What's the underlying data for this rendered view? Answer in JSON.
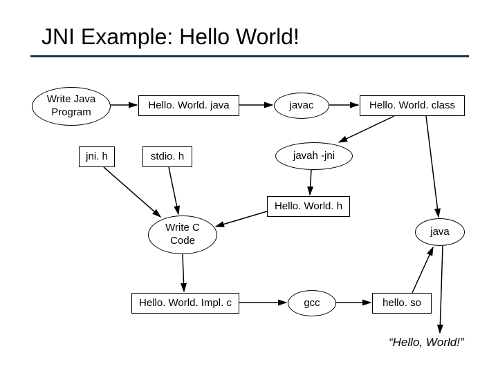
{
  "title": "JNI Example: Hello World!",
  "nodes": {
    "write_java": "Write Java\nProgram",
    "hello_java": "Hello. World. java",
    "javac": "javac",
    "hello_class": "Hello. World. class",
    "jni_h": "jni. h",
    "stdio_h": "stdio. h",
    "javah_jni": "javah -jni",
    "hello_h": "Hello. World. h",
    "write_c": "Write C\nCode",
    "java_run": "java",
    "hello_impl": "Hello. World. Impl. c",
    "gcc": "gcc",
    "hello_so": "hello. so",
    "output": "“Hello, World!”"
  }
}
